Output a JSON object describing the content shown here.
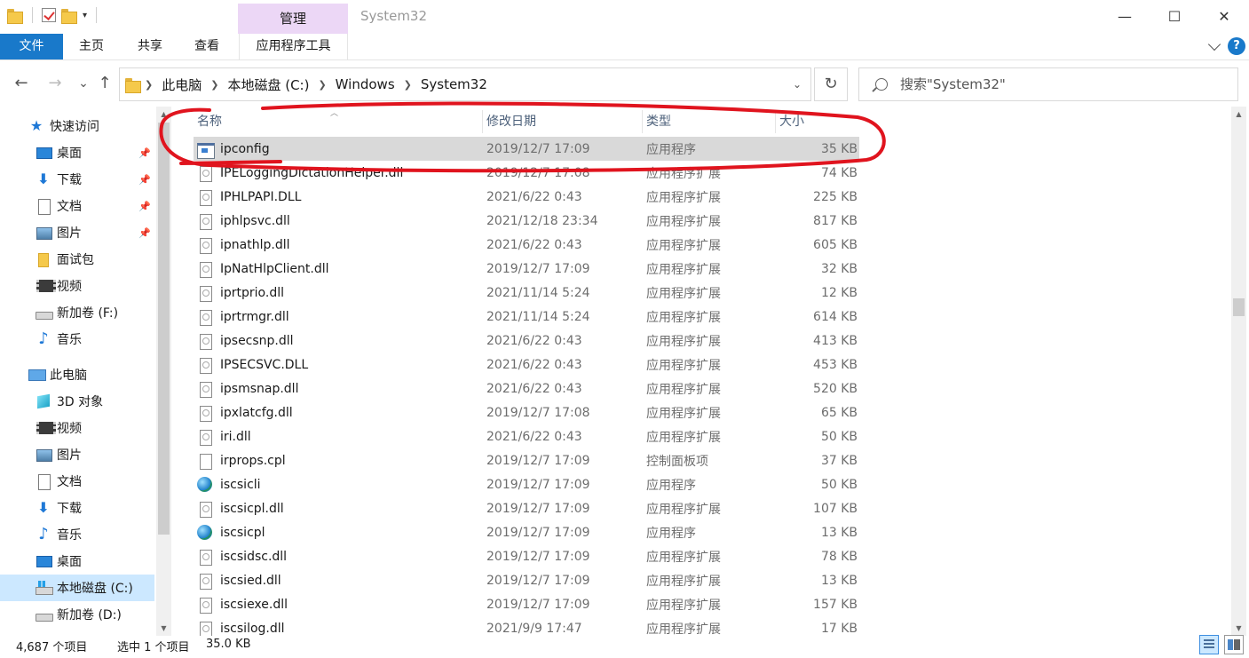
{
  "titlebar": {
    "manage_tab": "管理",
    "title": "System32",
    "minimize": "—",
    "maximize": "☐",
    "close": "✕",
    "quick_access_dropdown": "▾"
  },
  "ribbon": {
    "tabs": [
      "文件",
      "主页",
      "共享",
      "查看",
      "应用程序工具"
    ],
    "help": "?"
  },
  "address": {
    "back": "←",
    "forward": "→",
    "recent": "⌄",
    "up": "↑",
    "crumbs": [
      "此电脑",
      "本地磁盘 (C:)",
      "Windows",
      "System32"
    ],
    "dropdown": "⌄",
    "refresh": "↻"
  },
  "search": {
    "placeholder": "搜索\"System32\""
  },
  "nav": {
    "items": [
      {
        "label": "快速访问",
        "icon": "star-icon"
      },
      {
        "label": "桌面",
        "icon": "desktop-icon",
        "pinned": true
      },
      {
        "label": "下载",
        "icon": "download-icon",
        "pinned": true
      },
      {
        "label": "文档",
        "icon": "document-icon",
        "pinned": true
      },
      {
        "label": "图片",
        "icon": "pictures-icon",
        "pinned": true
      },
      {
        "label": "面试包",
        "icon": "folder-icon"
      },
      {
        "label": "视频",
        "icon": "video-icon"
      },
      {
        "label": "新加卷 (F:)",
        "icon": "drive-icon"
      },
      {
        "label": "音乐",
        "icon": "music-icon"
      },
      {
        "label": "此电脑",
        "icon": "this-pc-icon"
      },
      {
        "label": "3D 对象",
        "icon": "3d-objects-icon"
      },
      {
        "label": "视频",
        "icon": "video-icon"
      },
      {
        "label": "图片",
        "icon": "pictures-icon"
      },
      {
        "label": "文档",
        "icon": "document-icon"
      },
      {
        "label": "下载",
        "icon": "download-icon"
      },
      {
        "label": "音乐",
        "icon": "music-icon"
      },
      {
        "label": "桌面",
        "icon": "desktop-icon"
      },
      {
        "label": "本地磁盘 (C:)",
        "icon": "windows-drive-icon",
        "selected": true
      },
      {
        "label": "新加卷 (D:)",
        "icon": "drive-icon"
      }
    ]
  },
  "columns": {
    "name": "名称",
    "date": "修改日期",
    "type": "类型",
    "size": "大小"
  },
  "files": [
    {
      "name": "ipconfig",
      "date": "2019/12/7 17:09",
      "type": "应用程序",
      "size": "35 KB",
      "icon": "exe",
      "selected": true
    },
    {
      "name": "IPELoggingDictationHelper.dll",
      "date": "2019/12/7 17:08",
      "type": "应用程序扩展",
      "size": "74 KB",
      "icon": "dll"
    },
    {
      "name": "IPHLPAPI.DLL",
      "date": "2021/6/22 0:43",
      "type": "应用程序扩展",
      "size": "225 KB",
      "icon": "dll"
    },
    {
      "name": "iphlpsvc.dll",
      "date": "2021/12/18 23:34",
      "type": "应用程序扩展",
      "size": "817 KB",
      "icon": "dll"
    },
    {
      "name": "ipnathlp.dll",
      "date": "2021/6/22 0:43",
      "type": "应用程序扩展",
      "size": "605 KB",
      "icon": "dll"
    },
    {
      "name": "IpNatHlpClient.dll",
      "date": "2019/12/7 17:09",
      "type": "应用程序扩展",
      "size": "32 KB",
      "icon": "dll"
    },
    {
      "name": "iprtprio.dll",
      "date": "2021/11/14 5:24",
      "type": "应用程序扩展",
      "size": "12 KB",
      "icon": "dll"
    },
    {
      "name": "iprtrmgr.dll",
      "date": "2021/11/14 5:24",
      "type": "应用程序扩展",
      "size": "614 KB",
      "icon": "dll"
    },
    {
      "name": "ipsecsnp.dll",
      "date": "2021/6/22 0:43",
      "type": "应用程序扩展",
      "size": "413 KB",
      "icon": "dll"
    },
    {
      "name": "IPSECSVC.DLL",
      "date": "2021/6/22 0:43",
      "type": "应用程序扩展",
      "size": "453 KB",
      "icon": "dll"
    },
    {
      "name": "ipsmsnap.dll",
      "date": "2021/6/22 0:43",
      "type": "应用程序扩展",
      "size": "520 KB",
      "icon": "dll"
    },
    {
      "name": "ipxlatcfg.dll",
      "date": "2019/12/7 17:08",
      "type": "应用程序扩展",
      "size": "65 KB",
      "icon": "dll"
    },
    {
      "name": "iri.dll",
      "date": "2021/6/22 0:43",
      "type": "应用程序扩展",
      "size": "50 KB",
      "icon": "dll"
    },
    {
      "name": "irprops.cpl",
      "date": "2019/12/7 17:09",
      "type": "控制面板项",
      "size": "37 KB",
      "icon": "cpl"
    },
    {
      "name": "iscsicli",
      "date": "2019/12/7 17:09",
      "type": "应用程序",
      "size": "50 KB",
      "icon": "globe"
    },
    {
      "name": "iscsicpl.dll",
      "date": "2019/12/7 17:09",
      "type": "应用程序扩展",
      "size": "107 KB",
      "icon": "dll"
    },
    {
      "name": "iscsicpl",
      "date": "2019/12/7 17:09",
      "type": "应用程序",
      "size": "13 KB",
      "icon": "globe"
    },
    {
      "name": "iscsidsc.dll",
      "date": "2019/12/7 17:09",
      "type": "应用程序扩展",
      "size": "78 KB",
      "icon": "dll"
    },
    {
      "name": "iscsied.dll",
      "date": "2019/12/7 17:09",
      "type": "应用程序扩展",
      "size": "13 KB",
      "icon": "dll"
    },
    {
      "name": "iscsiexe.dll",
      "date": "2019/12/7 17:09",
      "type": "应用程序扩展",
      "size": "157 KB",
      "icon": "dll"
    },
    {
      "name": "iscsilog.dll",
      "date": "2021/9/9 17:47",
      "type": "应用程序扩展",
      "size": "17 KB",
      "icon": "dll"
    }
  ],
  "status": {
    "count": "4,687 个项目",
    "selected": "选中 1 个项目",
    "size": "35.0 KB"
  },
  "colors": {
    "accent": "#1979ca",
    "manage_tab": "#ecd7f6",
    "selected_row": "#d9d9d9",
    "selected_nav": "#cce8ff",
    "annotation": "#e0141e"
  }
}
